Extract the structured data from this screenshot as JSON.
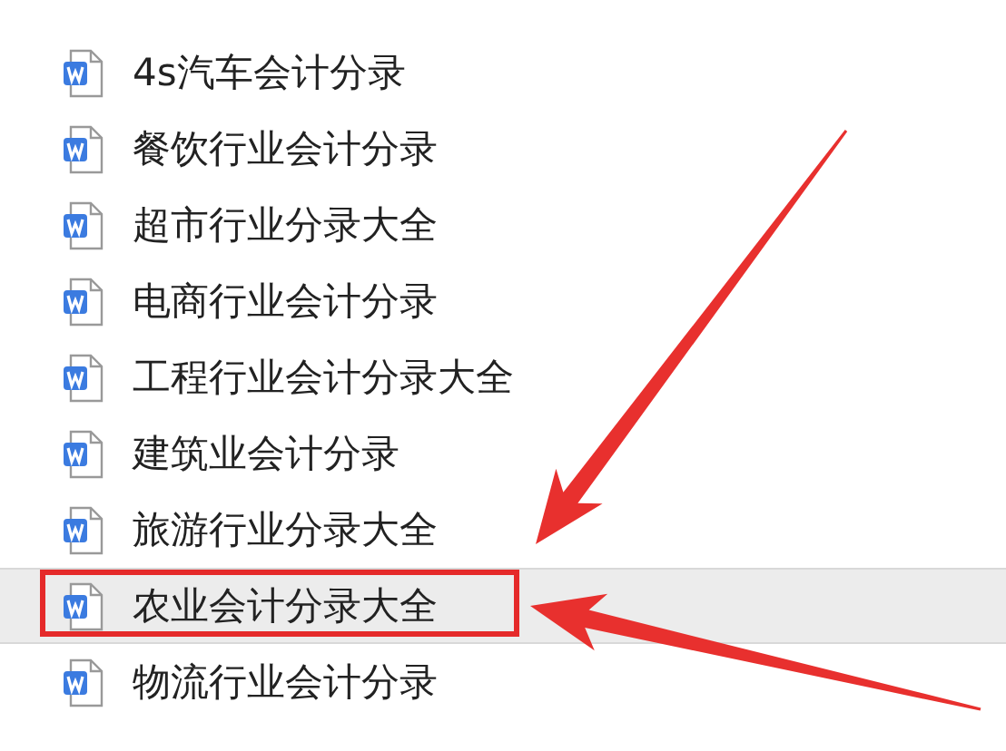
{
  "files": [
    {
      "name": "4s汽车会计分录",
      "selected": false,
      "highlighted": false
    },
    {
      "name": "餐饮行业会计分录",
      "selected": false,
      "highlighted": false
    },
    {
      "name": "超市行业分录大全",
      "selected": false,
      "highlighted": false
    },
    {
      "name": "电商行业会计分录",
      "selected": false,
      "highlighted": false
    },
    {
      "name": "工程行业会计分录大全",
      "selected": false,
      "highlighted": false
    },
    {
      "name": "建筑业会计分录",
      "selected": false,
      "highlighted": false
    },
    {
      "name": "旅游行业分录大全",
      "selected": false,
      "highlighted": false
    },
    {
      "name": "农业会计分录大全",
      "selected": true,
      "highlighted": true
    },
    {
      "name": "物流行业会计分录",
      "selected": false,
      "highlighted": false
    }
  ]
}
